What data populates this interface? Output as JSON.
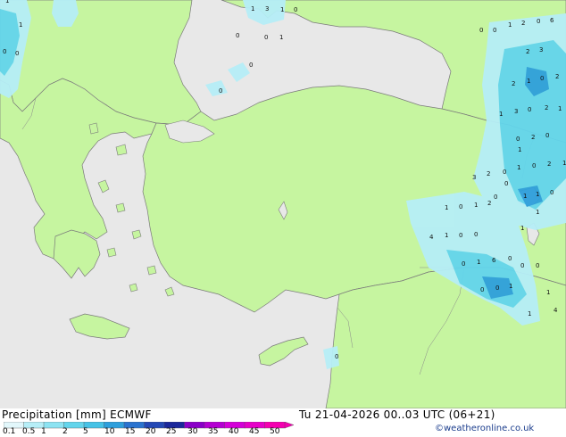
{
  "footer": {
    "title": "Precipitation [mm] ECMWF",
    "datetime": "Tu 21-04-2026 00..03 UTC (06+21)",
    "credit": "©weatheronline.co.uk"
  },
  "legend": {
    "ticks": [
      "0.1",
      "0.5",
      "1",
      "2",
      "5",
      "10",
      "15",
      "20",
      "25",
      "30",
      "35",
      "40",
      "45",
      "50"
    ],
    "colors": [
      "#e2f7fb",
      "#b6eef7",
      "#8ce3f2",
      "#63d5ec",
      "#46c2e6",
      "#2e9fdc",
      "#2a73cf",
      "#2448b5",
      "#1b279b",
      "#8a00c8",
      "#b400d2",
      "#d400d8",
      "#e600c8",
      "#f400b0"
    ]
  },
  "colors": {
    "sea": "#e8e8e8",
    "land": "#c6f5a0",
    "coast": "#7a7a7a",
    "precip_light": "#b6eef7",
    "precip_medium": "#63d5ec",
    "precip_heavy": "#2e9fdc"
  },
  "map_values": [
    "1",
    "3",
    "1",
    "0",
    "0",
    "0",
    "1",
    "0",
    "0",
    "1",
    "1",
    "0",
    "0",
    "0",
    "0",
    "1",
    "2",
    "0",
    "6",
    "2",
    "3",
    "2",
    "1",
    "0",
    "2",
    "1",
    "3",
    "0",
    "2",
    "1",
    "0",
    "2",
    "0",
    "3",
    "2",
    "0",
    "1",
    "0",
    "2",
    "1",
    "1",
    "1",
    "0",
    "1",
    "0",
    "1",
    "2",
    "1",
    "4",
    "1",
    "0",
    "0",
    "0",
    "1",
    "6",
    "0",
    "0",
    "0",
    "1",
    "0",
    "1",
    "0",
    "0",
    "1",
    "1",
    "0",
    "4",
    "0",
    "1"
  ]
}
